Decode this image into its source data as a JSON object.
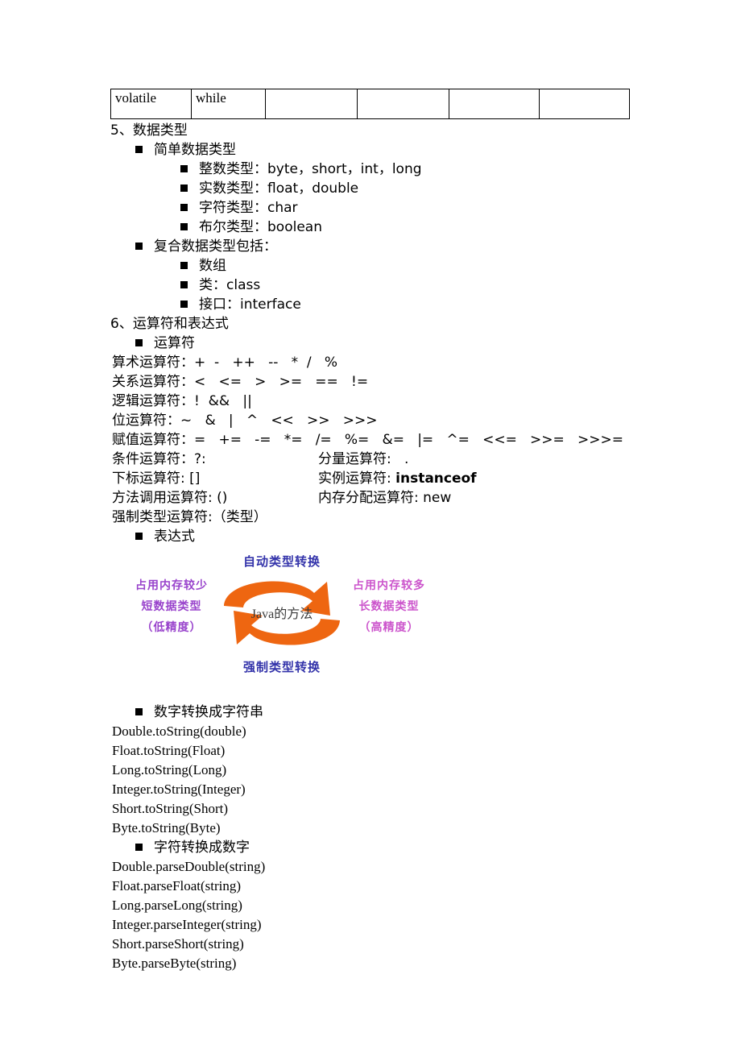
{
  "colors": {
    "arrow_orange": "#EE6611",
    "heading_blue": "#3333AA",
    "left_violet": "#9944CC",
    "right_magenta": "#CC55CC",
    "text_black": "#000000",
    "center_gray": "#3A3A3A"
  },
  "keyword_table": {
    "rows": [
      [
        "volatile",
        "while",
        "",
        "",
        "",
        ""
      ]
    ]
  },
  "sections": [
    {
      "number": "5、",
      "title": "数据类型",
      "items": [
        {
          "level": 1,
          "text": "简单数据类型",
          "children": [
            {
              "level": 2,
              "text": "整数类型：byte，short，int，long"
            },
            {
              "level": 2,
              "text": "实数类型：float，double"
            },
            {
              "level": 2,
              "text": "字符类型：char"
            },
            {
              "level": 2,
              "text": "布尔类型：boolean"
            }
          ]
        },
        {
          "level": 1,
          "text": "复合数据类型包括：",
          "children": [
            {
              "level": 2,
              "text": "数组"
            },
            {
              "level": 2,
              "text": "类：class"
            },
            {
              "level": 2,
              "text": "接口：interface"
            }
          ]
        }
      ]
    }
  ],
  "section6": {
    "number": "6、",
    "title": "运算符和表达式",
    "bullet_operators": "运算符",
    "bullet_expressions": "表达式",
    "operator_lines": [
      "算术运算符：+  -   ++   --   *  /   %",
      "关系运算符：<   <=   >   >=   ==   !=",
      "逻辑运算符：!  &&   ||",
      "位运算符：~   &   |   ^   <<   >>   >>>",
      "赋值运算符：=   +=   -=   *=   /=   %=   &=   |=   ^=   <<=   >>=   >>>="
    ],
    "operator_pairs": [
      {
        "left": "条件运算符：?:",
        "right": "分量运算符:   .",
        "right_bold": ""
      },
      {
        "left": "下标运算符: []",
        "right": "实例运算符: ",
        "right_bold": "instanceof"
      },
      {
        "left": "方法调用运算符: ()",
        "right": "内存分配运算符: new",
        "right_bold": ""
      },
      {
        "left": "强制类型运算符:（类型）",
        "right": "",
        "right_bold": ""
      }
    ]
  },
  "diagram": {
    "title_top": "自动类型转换",
    "title_bottom": "强制类型转换",
    "center_latin": "Java",
    "center_cjk": "的方法",
    "left_lines": [
      "占用内存较少",
      "短数据类型",
      "（低精度）"
    ],
    "right_lines": [
      "占用内存较多",
      "长数据类型",
      "（高精度）"
    ]
  },
  "num_to_string": {
    "bullet": "数字转换成字符串",
    "lines": [
      "Double.toString(double)",
      "Float.toString(Float)",
      "Long.toString(Long)",
      "Integer.toString(Integer)",
      "Short.toString(Short)",
      "Byte.toString(Byte)"
    ]
  },
  "string_to_num": {
    "bullet": "字符转换成数字",
    "lines": [
      "Double.parseDouble(string)",
      "Float.parseFloat(string)",
      "Long.parseLong(string)",
      "Integer.parseInteger(string)",
      "Short.parseShort(string)",
      "Byte.parseByte(string)"
    ]
  }
}
